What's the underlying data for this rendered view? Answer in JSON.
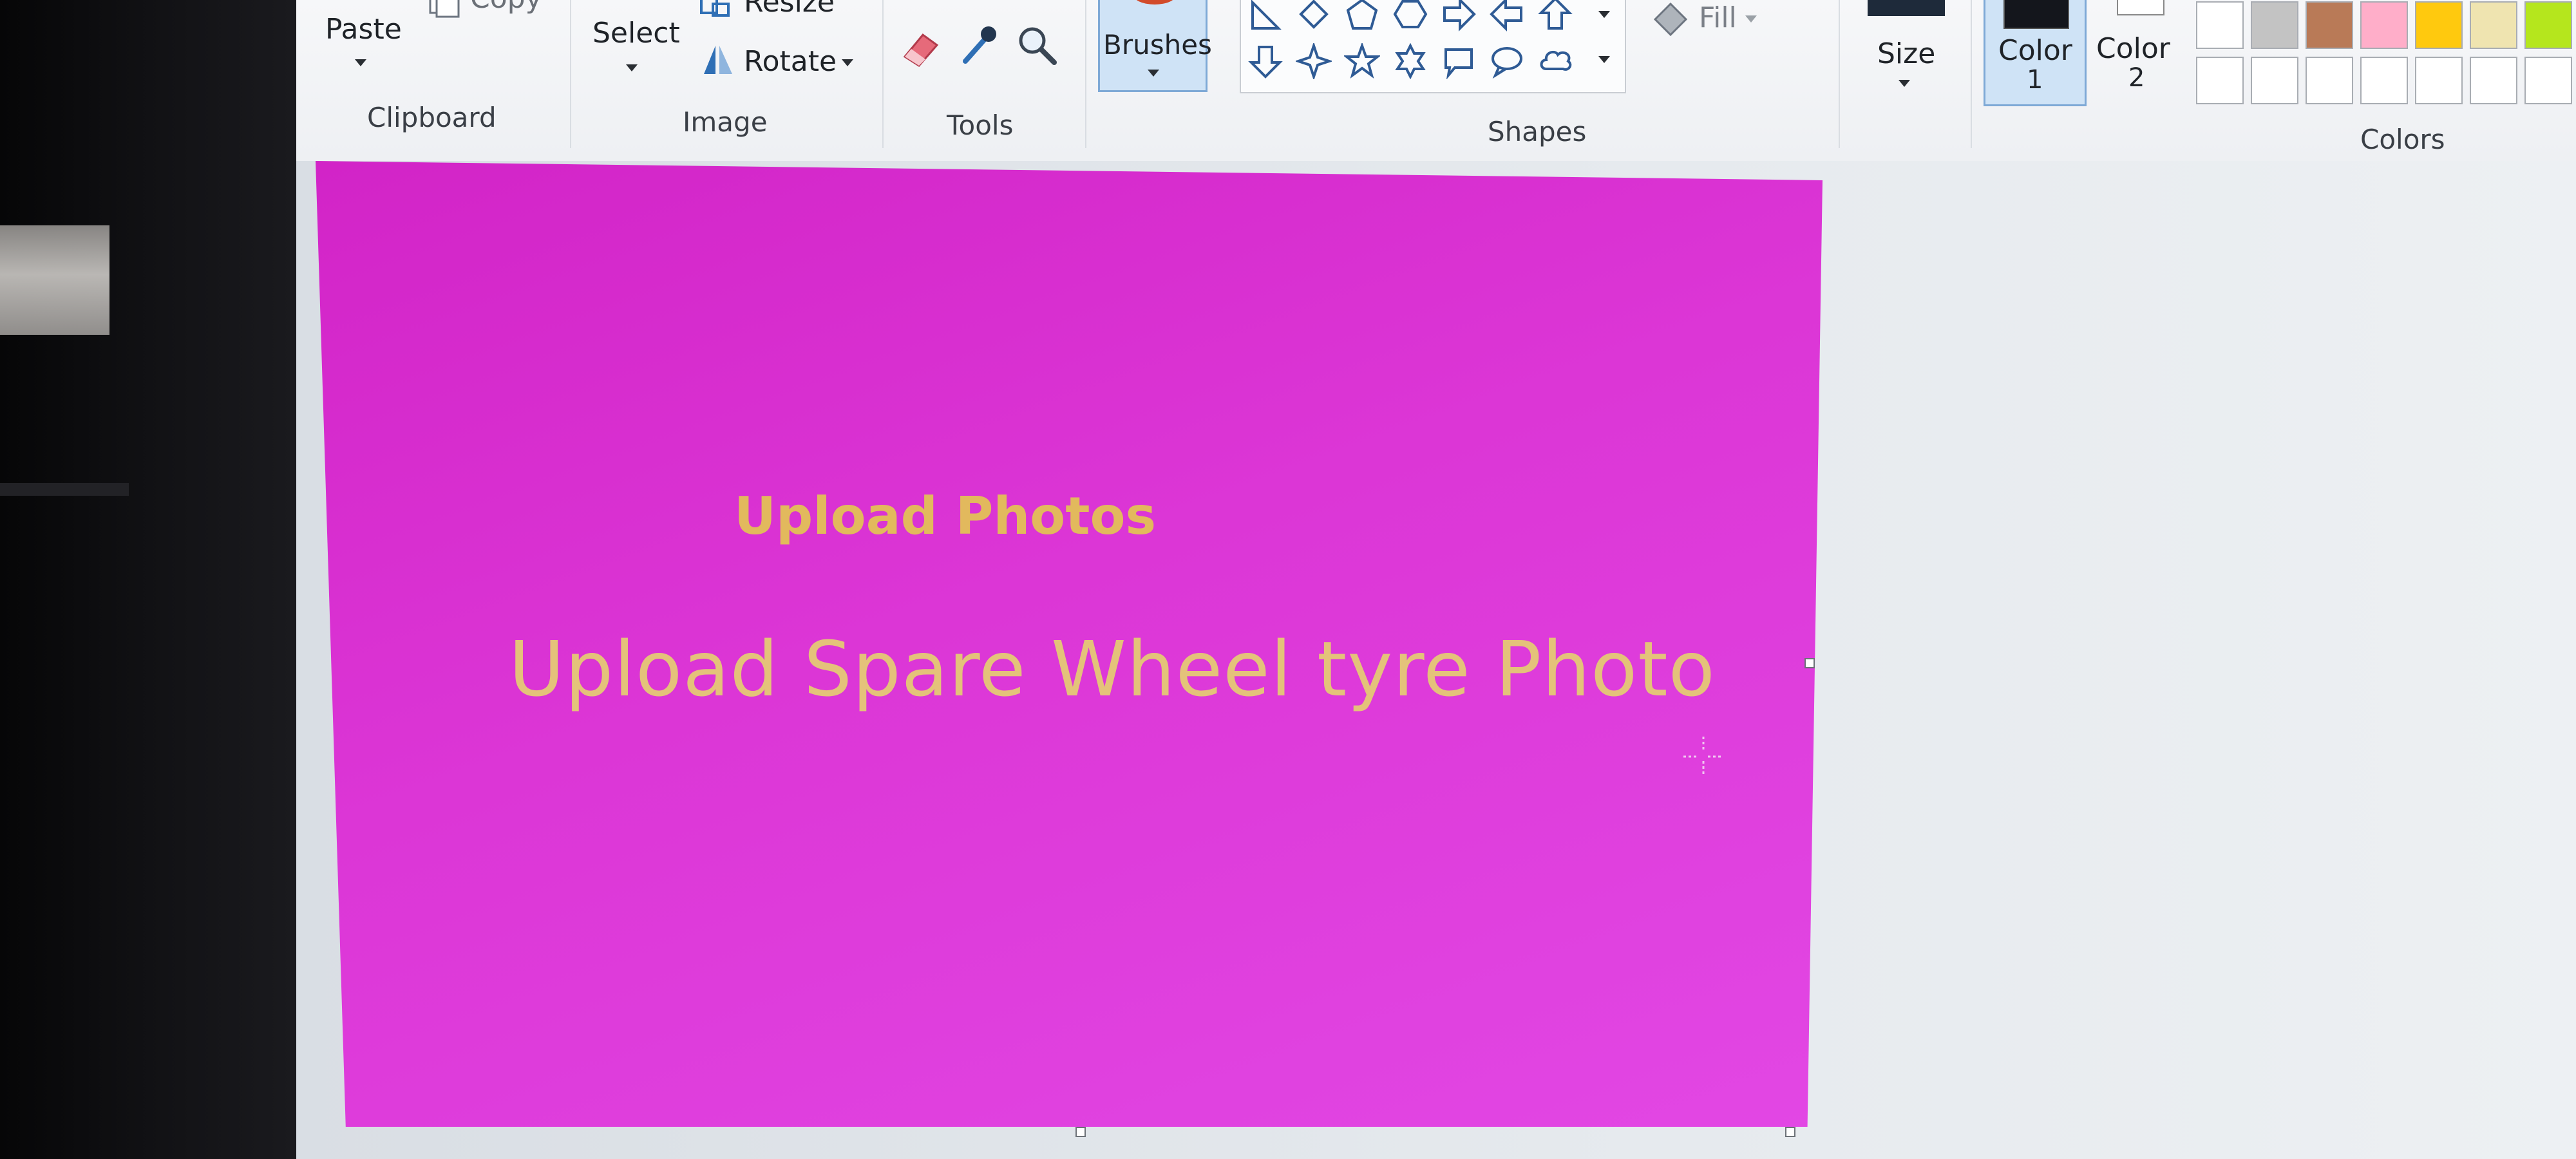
{
  "ribbon": {
    "clipboard": {
      "paste_label": "Paste",
      "copy_label": "Copy",
      "group_label": "Clipboard"
    },
    "image": {
      "select_label": "Select",
      "resize_label": "Resize",
      "rotate_label": "Rotate",
      "group_label": "Image"
    },
    "tools": {
      "group_label": "Tools",
      "icons": [
        "eraser-icon",
        "color-picker-icon",
        "magnifier-icon"
      ]
    },
    "brushes": {
      "label": "Brushes"
    },
    "shapes": {
      "group_label": "Shapes",
      "fill_label": "Fill"
    },
    "size": {
      "label": "Size"
    },
    "colors": {
      "color1_label": "Color",
      "color1_number": "1",
      "color2_label": "Color",
      "color2_number": "2",
      "group_label": "Colors",
      "color1_value": "#14161c",
      "palette_row1": [
        "#ffffff",
        "#c3c3c3",
        "#b97a57",
        "#ffaec9",
        "#ffc90e",
        "#efe4b0",
        "#b5e61d"
      ],
      "palette_row2": [
        "#ffffff",
        "#ffffff",
        "#ffffff",
        "#ffffff",
        "#ffffff",
        "#ffffff",
        "#ffffff"
      ]
    }
  },
  "canvas": {
    "background": "#dc36d6",
    "title": "Upload Photos",
    "subtitle": "Upload Spare Wheel tyre Photo",
    "text_color": "#e2b95d"
  }
}
